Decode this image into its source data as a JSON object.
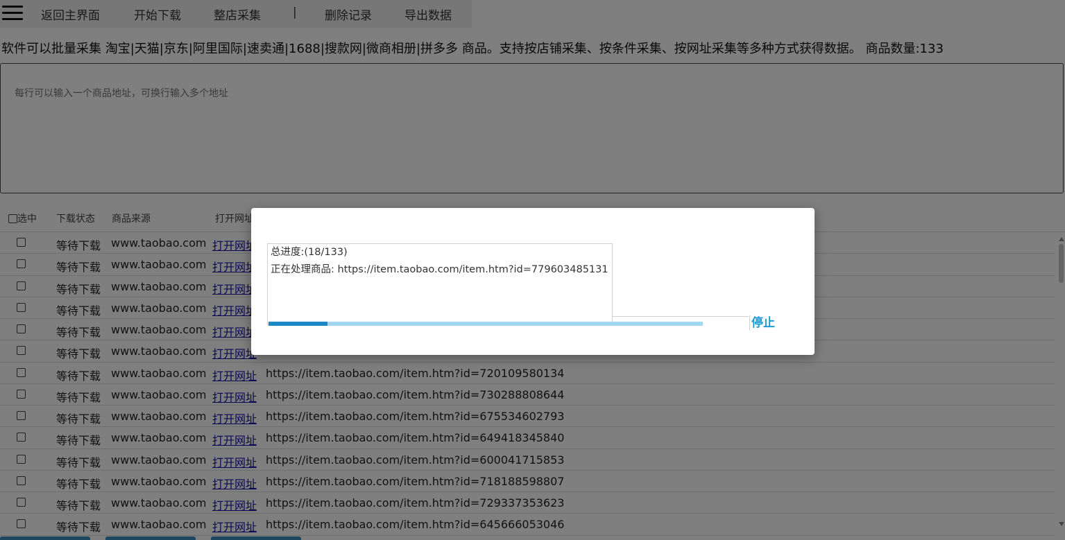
{
  "toolbar": {
    "items": [
      "返回主界面",
      "开始下载",
      "整店采集",
      "删除记录",
      "导出数据"
    ],
    "separator": "|"
  },
  "info_text": "软件可以批量采集 淘宝|天猫|京东|阿里国际|速卖通|1688|搜款网|微商相册|拼多多 商品。支持按店铺采集、按条件采集、按网址采集等多种方式获得数据。 商品数量:133",
  "url_input": {
    "placeholder": "每行可以输入一个商品地址，可换行输入多个地址",
    "value": ""
  },
  "table": {
    "headers": {
      "select": "选中",
      "status": "下载状态",
      "source": "商品来源",
      "open": "打开网址"
    },
    "rows": [
      {
        "status": "等待下载",
        "source": "www.taobao.com",
        "open": "打开网址",
        "url": ""
      },
      {
        "status": "等待下载",
        "source": "www.taobao.com",
        "open": "打开网址",
        "url": ""
      },
      {
        "status": "等待下载",
        "source": "www.taobao.com",
        "open": "打开网址",
        "url": ""
      },
      {
        "status": "等待下载",
        "source": "www.taobao.com",
        "open": "打开网址",
        "url": ""
      },
      {
        "status": "等待下载",
        "source": "www.taobao.com",
        "open": "打开网址",
        "url": ""
      },
      {
        "status": "等待下载",
        "source": "www.taobao.com",
        "open": "打开网址",
        "url": ""
      },
      {
        "status": "等待下载",
        "source": "www.taobao.com",
        "open": "打开网址",
        "url": "https://item.taobao.com/item.htm?id=720109580134"
      },
      {
        "status": "等待下载",
        "source": "www.taobao.com",
        "open": "打开网址",
        "url": "https://item.taobao.com/item.htm?id=730288808644"
      },
      {
        "status": "等待下载",
        "source": "www.taobao.com",
        "open": "打开网址",
        "url": "https://item.taobao.com/item.htm?id=675534602793"
      },
      {
        "status": "等待下载",
        "source": "www.taobao.com",
        "open": "打开网址",
        "url": "https://item.taobao.com/item.htm?id=649418345840"
      },
      {
        "status": "等待下载",
        "source": "www.taobao.com",
        "open": "打开网址",
        "url": "https://item.taobao.com/item.htm?id=600041715853"
      },
      {
        "status": "等待下载",
        "source": "www.taobao.com",
        "open": "打开网址",
        "url": "https://item.taobao.com/item.htm?id=718188598807"
      },
      {
        "status": "等待下载",
        "source": "www.taobao.com",
        "open": "打开网址",
        "url": "https://item.taobao.com/item.htm?id=729337353623"
      },
      {
        "status": "等待下载",
        "source": "www.taobao.com",
        "open": "打开网址",
        "url": "https://item.taobao.com/item.htm?id=645666053046"
      }
    ]
  },
  "dialog": {
    "progress_text": "总进度:(18/133)",
    "processing_text": "正在处理商品: https://item.taobao.com/item.htm?id=779603485131",
    "progress_fraction": 0.135,
    "stop_label": "停止"
  },
  "colors": {
    "accent": "#1a9bd6",
    "progress_fill": "#1e88c7",
    "progress_track": "#a3d6ef",
    "link": "#1a0dab",
    "overlay": "rgba(0,0,0,0.5)"
  },
  "icons": {
    "menu": "hamburger-menu-icon",
    "checkbox": "checkbox-icon"
  }
}
